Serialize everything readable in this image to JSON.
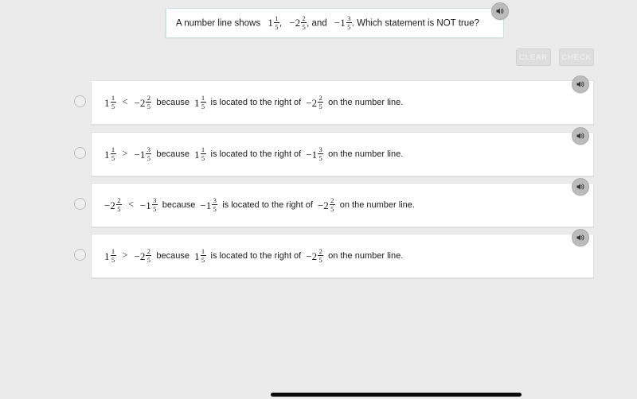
{
  "page": {
    "background_color": "#ebebeb",
    "card_color": "#ffffff"
  },
  "question": {
    "prefix": "A number line shows",
    "numbers": [
      {
        "whole": "1",
        "num": "1",
        "den": "5",
        "sign": ""
      },
      {
        "whole": "2",
        "num": "2",
        "den": "5",
        "sign": "−"
      },
      {
        "whole": "1",
        "num": "3",
        "den": "5",
        "sign": "−"
      }
    ],
    "separator_1": ",",
    "separator_2": ", and",
    "suffix": ". Which statement is NOT true?",
    "speaker_icon": "speaker-icon"
  },
  "toolbar": {
    "clear_label": "CLEAR",
    "check_label": "CHECK",
    "disabled": true,
    "button_bg": "#dedede",
    "button_text_color": "#f4f4f4"
  },
  "options": [
    {
      "id": "option-a",
      "selected": false,
      "left": {
        "sign": "",
        "whole": "1",
        "num": "1",
        "den": "5"
      },
      "operator": "<",
      "right": {
        "sign": "−",
        "whole": "2",
        "num": "2",
        "den": "5"
      },
      "because": "because",
      "subject": {
        "sign": "",
        "whole": "1",
        "num": "1",
        "den": "5"
      },
      "middle_text": "is located to the right of",
      "object": {
        "sign": "−",
        "whole": "2",
        "num": "2",
        "den": "5"
      },
      "tail_text": "on the number line.",
      "speaker_icon": "speaker-icon"
    },
    {
      "id": "option-b",
      "selected": false,
      "left": {
        "sign": "",
        "whole": "1",
        "num": "1",
        "den": "5"
      },
      "operator": ">",
      "right": {
        "sign": "−",
        "whole": "1",
        "num": "3",
        "den": "5"
      },
      "because": "because",
      "subject": {
        "sign": "",
        "whole": "1",
        "num": "1",
        "den": "5"
      },
      "middle_text": "is located to the right of",
      "object": {
        "sign": "−",
        "whole": "1",
        "num": "3",
        "den": "5"
      },
      "tail_text": "on the number line.",
      "speaker_icon": "speaker-icon"
    },
    {
      "id": "option-c",
      "selected": false,
      "left": {
        "sign": "−",
        "whole": "2",
        "num": "2",
        "den": "5"
      },
      "operator": "<",
      "right": {
        "sign": "−",
        "whole": "1",
        "num": "3",
        "den": "5"
      },
      "because": "because",
      "subject": {
        "sign": "−",
        "whole": "1",
        "num": "3",
        "den": "5"
      },
      "middle_text": "is located to the right of",
      "object": {
        "sign": "−",
        "whole": "2",
        "num": "2",
        "den": "5"
      },
      "tail_text": "on the number line.",
      "speaker_icon": "speaker-icon"
    },
    {
      "id": "option-d",
      "selected": false,
      "left": {
        "sign": "",
        "whole": "1",
        "num": "1",
        "den": "5"
      },
      "operator": ">",
      "right": {
        "sign": "−",
        "whole": "2",
        "num": "2",
        "den": "5"
      },
      "because": "because",
      "subject": {
        "sign": "",
        "whole": "1",
        "num": "1",
        "den": "5"
      },
      "middle_text": "is located to the right of",
      "object": {
        "sign": "−",
        "whole": "2",
        "num": "2",
        "den": "5"
      },
      "tail_text": "on the number line.",
      "speaker_icon": "speaker-icon"
    }
  ],
  "scrollbar": {
    "name": "horizontal-scrollbar",
    "thumb_color": "#0b0b0b"
  }
}
